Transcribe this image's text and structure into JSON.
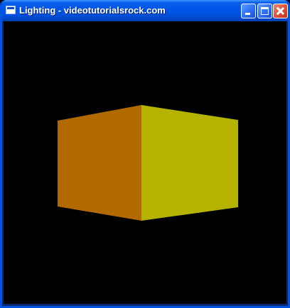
{
  "window": {
    "title": "Lighting - videotutorialsrock.com",
    "icon": "window-app-icon",
    "controls": [
      "minimize",
      "maximize",
      "close"
    ]
  },
  "scene": {
    "background": "#000000",
    "cube": {
      "left_face_color": "#b06a00",
      "right_face_color": "#b3b300"
    }
  }
}
